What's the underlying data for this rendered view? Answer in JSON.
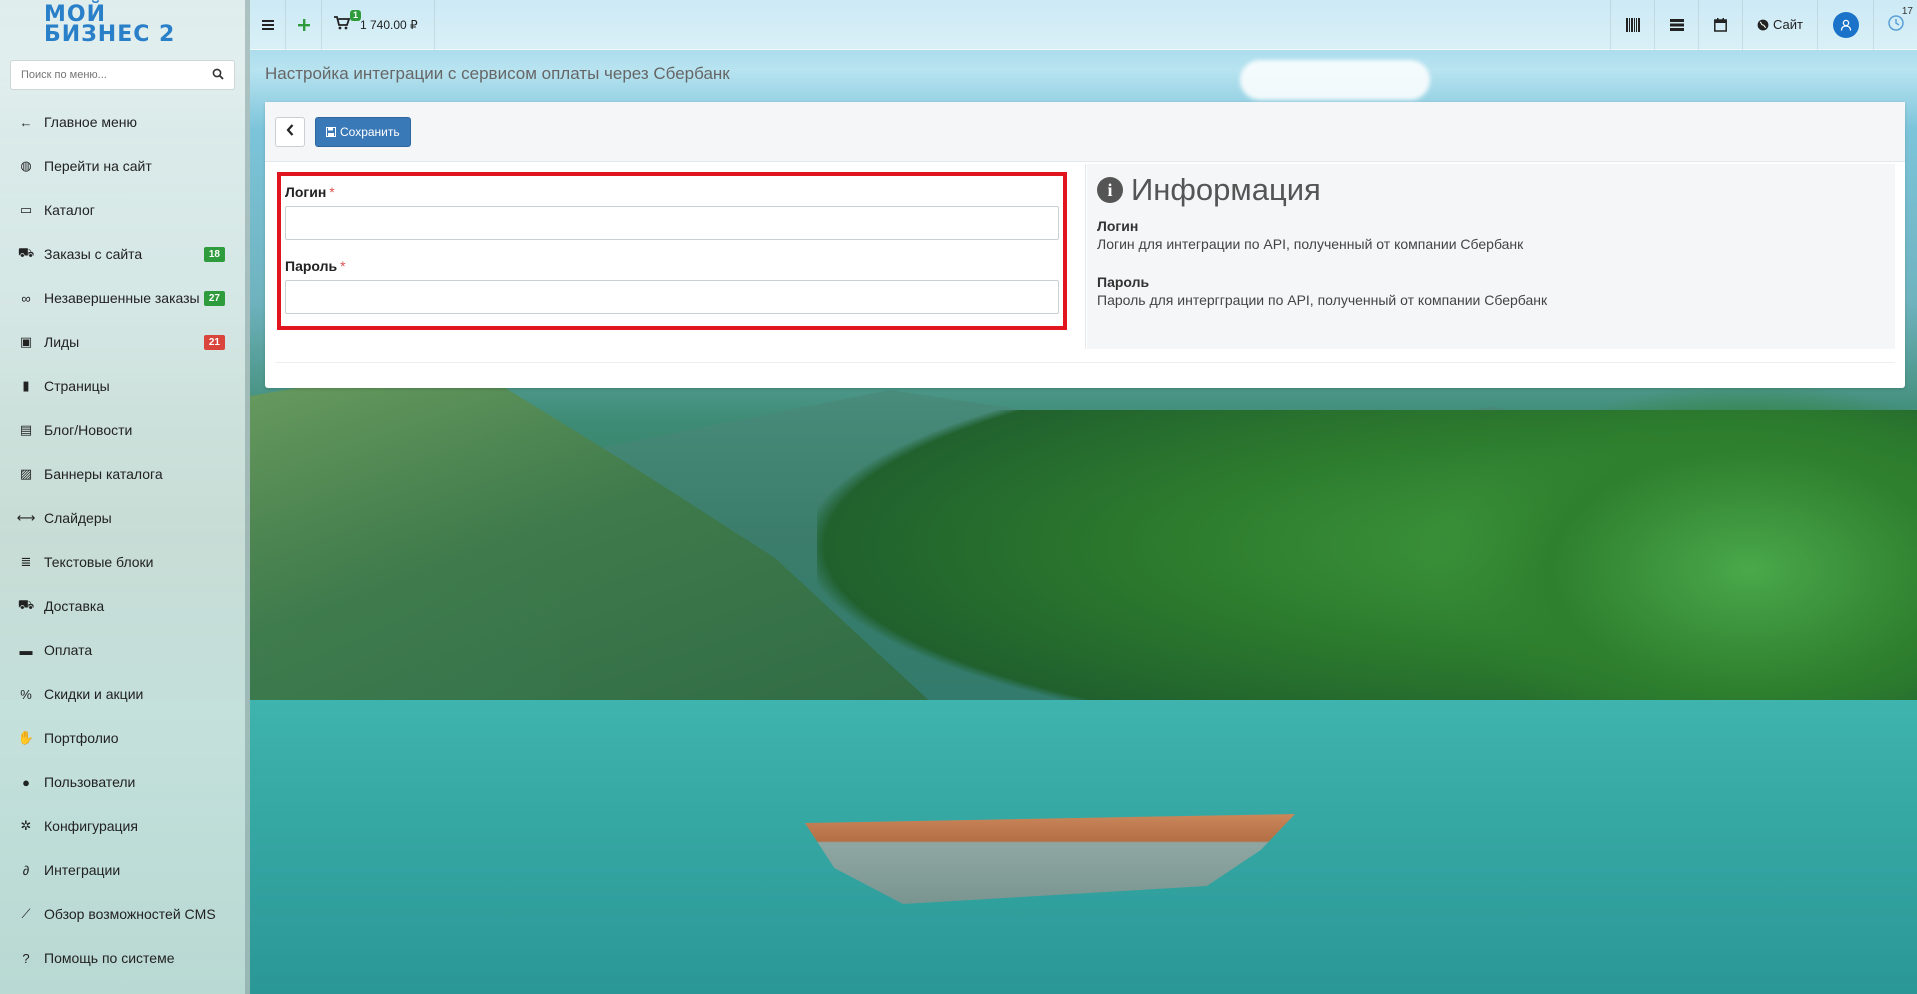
{
  "app": {
    "logo_line1": "МОЙ",
    "logo_line2": "БИЗНЕС 2"
  },
  "topbar": {
    "menu_icon": "bars-icon",
    "add_icon": "plus-icon",
    "cart_badge": "1",
    "cart_total": "1 740.00 ₽",
    "site_label": "Сайт",
    "notifications_count": "17"
  },
  "sidebar": {
    "search_placeholder": "Поиск по меню...",
    "items": [
      {
        "label": "Главное меню",
        "icon": "arrow-left-icon"
      },
      {
        "label": "Перейти на сайт",
        "icon": "globe-icon"
      },
      {
        "label": "Каталог",
        "icon": "folder-icon"
      },
      {
        "label": "Заказы с сайта",
        "icon": "cart-icon",
        "badge": "18",
        "badge_color": "#2e9c3c"
      },
      {
        "label": "Незавершенные заказы",
        "icon": "link-icon",
        "badge": "27",
        "badge_color": "#2e9c3c"
      },
      {
        "label": "Лиды",
        "icon": "contact-icon",
        "badge": "21",
        "badge_color": "#d9453a"
      },
      {
        "label": "Страницы",
        "icon": "file-icon"
      },
      {
        "label": "Блог/Новости",
        "icon": "newspaper-icon"
      },
      {
        "label": "Баннеры каталога",
        "icon": "image-icon"
      },
      {
        "label": "Слайдеры",
        "icon": "arrows-h-icon"
      },
      {
        "label": "Текстовые блоки",
        "icon": "file-text-icon"
      },
      {
        "label": "Доставка",
        "icon": "truck-icon"
      },
      {
        "label": "Оплата",
        "icon": "credit-card-icon"
      },
      {
        "label": "Скидки и акции",
        "icon": "percent-icon"
      },
      {
        "label": "Портфолио",
        "icon": "thumbs-up-icon"
      },
      {
        "label": "Пользователи",
        "icon": "user-icon"
      },
      {
        "label": "Конфигурация",
        "icon": "cog-icon"
      },
      {
        "label": "Интеграции",
        "icon": "paperclip-icon"
      },
      {
        "label": "Обзор возможностей CMS",
        "icon": "chart-line-icon"
      },
      {
        "label": "Помощь по системе",
        "icon": "question-icon"
      }
    ]
  },
  "main": {
    "page_title": "Настройка интеграции с сервисом оплаты через Сбербанк",
    "save_label": "Сохранить",
    "form": {
      "login_label": "Логин",
      "password_label": "Пароль",
      "required_mark": "*",
      "login_value": "",
      "password_value": ""
    },
    "info": {
      "title": "Информация",
      "login_head": "Логин",
      "login_text": "Логин для интеграции по API, полученный от компании Сбербанк",
      "password_head": "Пароль",
      "password_text": "Пароль для интергграции по API, полученный от компании Сбербанк"
    }
  }
}
